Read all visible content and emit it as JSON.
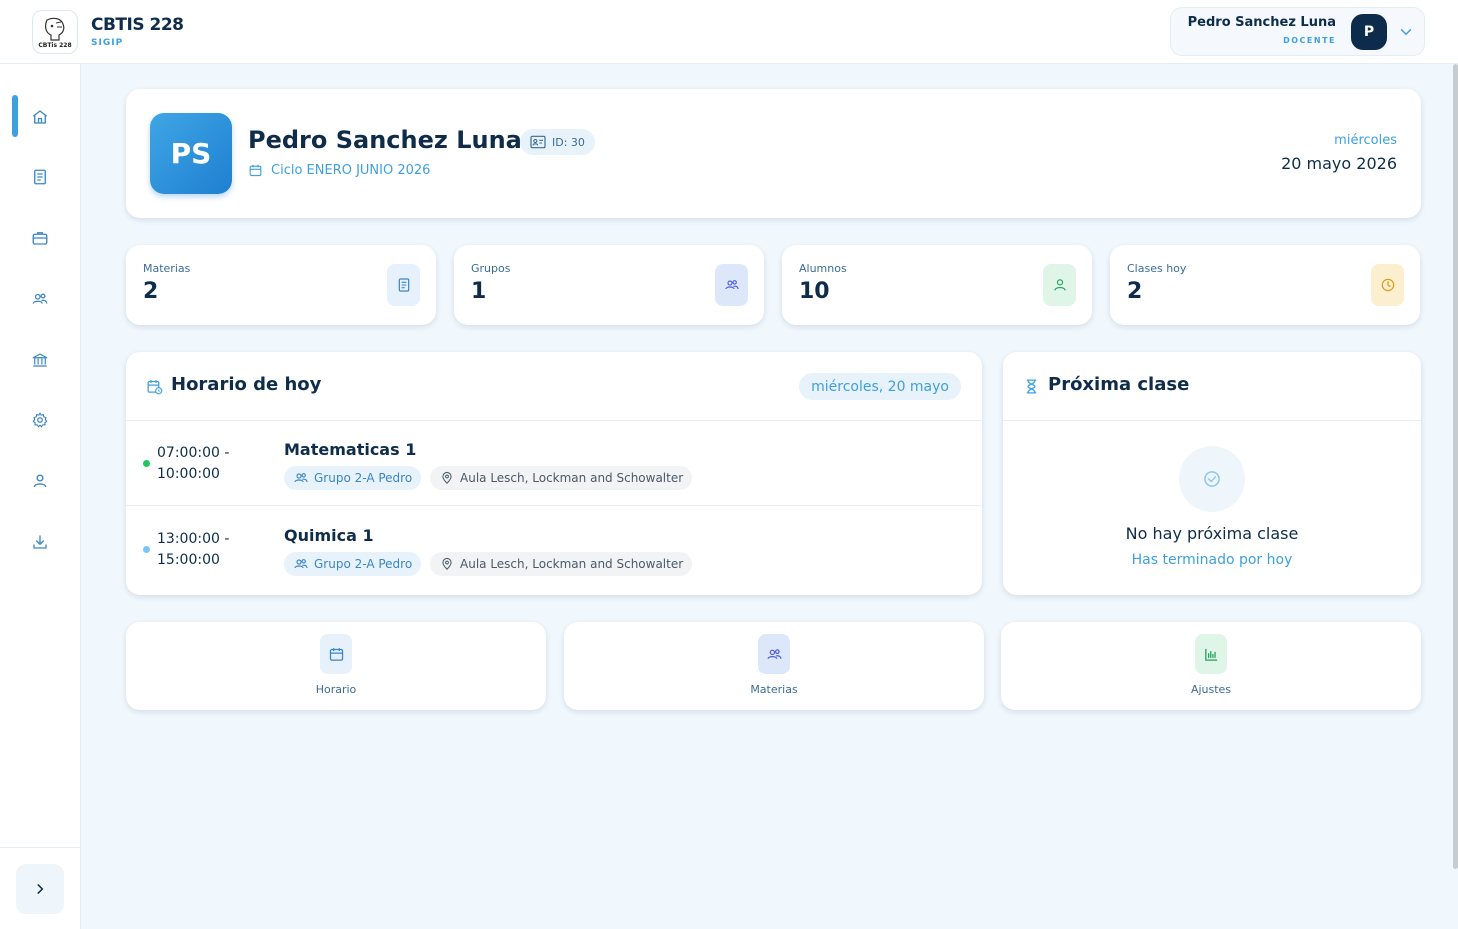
{
  "app": {
    "title": "CBTIS 228",
    "subtitle": "SIGIP",
    "logo_text": "CBTis 228"
  },
  "user_menu": {
    "name": "Pedro Sanchez Luna",
    "role": "DOCENTE",
    "avatar_initial": "P"
  },
  "sidebar": {
    "items": [
      {
        "name": "home",
        "icon": "home-icon",
        "active": true
      },
      {
        "name": "materias",
        "icon": "book-icon",
        "active": false
      },
      {
        "name": "briefcase",
        "icon": "briefcase-icon",
        "active": false
      },
      {
        "name": "grupos",
        "icon": "users-icon",
        "active": false
      },
      {
        "name": "institucion",
        "icon": "building-icon",
        "active": false
      },
      {
        "name": "ajustes",
        "icon": "gear-icon",
        "active": false
      },
      {
        "name": "perfil",
        "icon": "user-icon",
        "active": false
      },
      {
        "name": "descargas",
        "icon": "download-icon",
        "active": false
      }
    ]
  },
  "profile": {
    "initials": "PS",
    "name": "Pedro Sanchez Luna",
    "id_label": "ID: 30",
    "cycle": "Ciclo ENERO JUNIO 2026",
    "weekday": "miércoles",
    "date": "20 mayo 2026"
  },
  "stats": [
    {
      "label": "Materias",
      "value": "2",
      "icon": "book-icon",
      "color": "#3b86c4",
      "bg": "#e6f1fb"
    },
    {
      "label": "Grupos",
      "value": "1",
      "icon": "users-icon",
      "color": "#4f5fd6",
      "bg": "#e3ebfb"
    },
    {
      "label": "Alumnos",
      "value": "10",
      "icon": "user-icon",
      "color": "#22a05a",
      "bg": "#e2f6ea"
    },
    {
      "label": "Clases hoy",
      "value": "2",
      "icon": "clock-icon",
      "color": "#d99a12",
      "bg": "#fdf2d6"
    }
  ],
  "schedule": {
    "title": "Horario de hoy",
    "date_chip": "miércoles, 20 mayo",
    "classes": [
      {
        "start": "07:00:00 -",
        "end": "10:00:00",
        "subject": "Matematicas 1",
        "group": "Grupo 2-A Pedro",
        "room": "Aula Lesch, Lockman and Schowalter",
        "dot_color": "#22c55e"
      },
      {
        "start": "13:00:00 -",
        "end": "15:00:00",
        "subject": "Quimica 1",
        "group": "Grupo 2-A Pedro",
        "room": "Aula Lesch, Lockman and Schowalter",
        "dot_color": "#7cc4f2"
      }
    ]
  },
  "next_class": {
    "title": "Próxima clase",
    "empty_title": "No hay próxima clase",
    "empty_subtitle": "Has terminado por hoy"
  },
  "quick_links": [
    {
      "label": "Horario",
      "icon": "calendar-icon",
      "color": "#3b86c4",
      "bg": "#e6f1fb"
    },
    {
      "label": "Materias",
      "icon": "users-icon",
      "color": "#4f5fd6",
      "bg": "#e3ebfb"
    },
    {
      "label": "Ajustes",
      "icon": "bar-chart-icon",
      "color": "#22a05a",
      "bg": "#e2f6ea"
    }
  ]
}
